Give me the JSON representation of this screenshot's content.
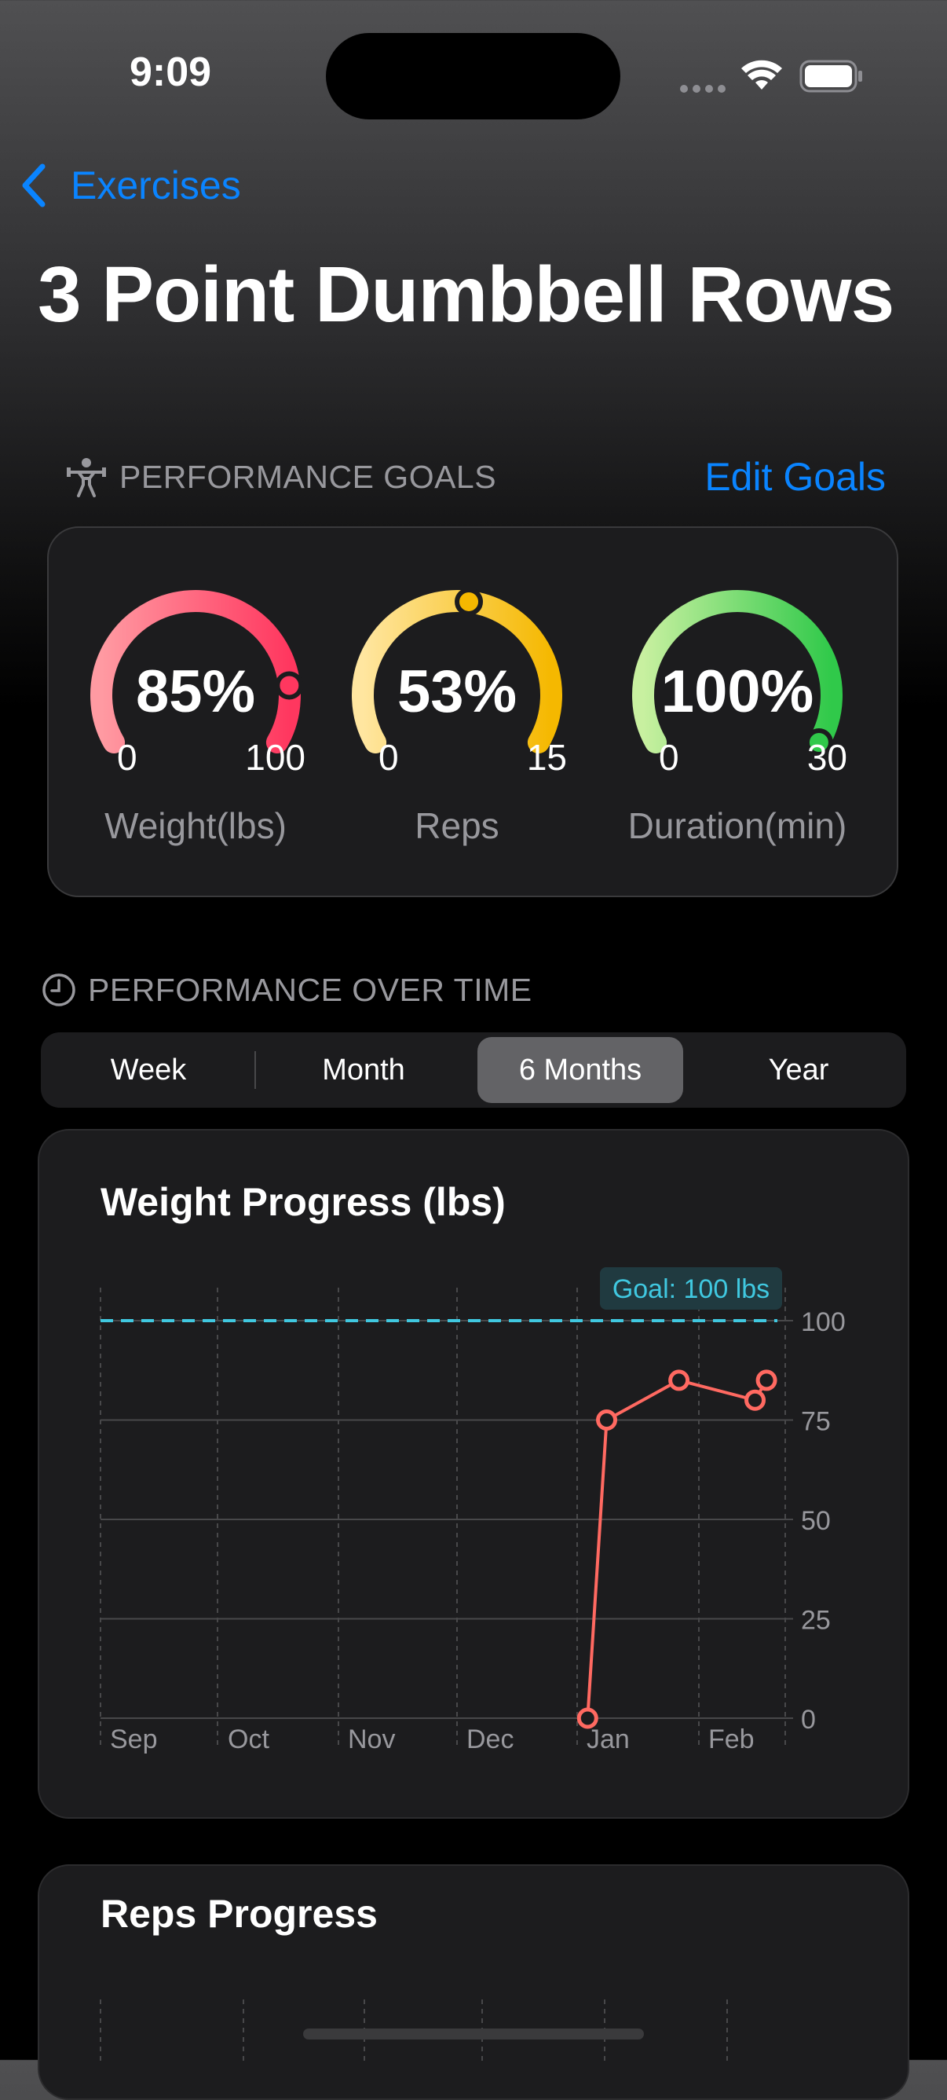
{
  "status_bar": {
    "time": "9:09"
  },
  "nav": {
    "back_label": "Exercises"
  },
  "page_title": "3 Point Dumbbell Rows",
  "goals_section": {
    "header": "PERFORMANCE GOALS",
    "action": "Edit Goals",
    "gauges": [
      {
        "percent_label": "85%",
        "value": 0.85,
        "min": "0",
        "max": "100",
        "label": "Weight(lbs)",
        "color_from": "#ff9aa2",
        "color_to": "#ff375f"
      },
      {
        "percent_label": "53%",
        "value": 0.53,
        "min": "0",
        "max": "15",
        "label": "Reps",
        "color_from": "#ffe6a0",
        "color_to": "#f5b800"
      },
      {
        "percent_label": "100%",
        "value": 1.0,
        "min": "0",
        "max": "30",
        "label": "Duration(min)",
        "color_from": "#c8f0a0",
        "color_to": "#30c94a"
      }
    ]
  },
  "time_section": {
    "header": "PERFORMANCE OVER TIME",
    "segments": [
      "Week",
      "Month",
      "6 Months",
      "Year"
    ],
    "selected_segment": "6 Months"
  },
  "weight_chart": {
    "title": "Weight Progress (lbs)"
  },
  "reps_chart": {
    "title": "Reps Progress"
  },
  "chart_data": {
    "type": "line",
    "title": "Weight Progress (lbs)",
    "xlabel": "",
    "ylabel": "",
    "x_ticks": [
      "Sep",
      "Oct",
      "Nov",
      "Dec",
      "Jan",
      "Feb"
    ],
    "y_ticks": [
      0,
      25,
      50,
      75,
      100
    ],
    "ylim": [
      0,
      100
    ],
    "goal": {
      "label": "Goal: 100 lbs",
      "value": 100,
      "color": "#40c8e0"
    },
    "series": [
      {
        "color": "#ff6961",
        "points": [
          {
            "x": "2025-01-01",
            "y": 0
          },
          {
            "x": "2025-01-06",
            "y": 75
          },
          {
            "x": "2025-01-25",
            "y": 85
          },
          {
            "x": "2025-02-14",
            "y": 80
          },
          {
            "x": "2025-02-17",
            "y": 85
          }
        ]
      }
    ],
    "grid": true
  }
}
